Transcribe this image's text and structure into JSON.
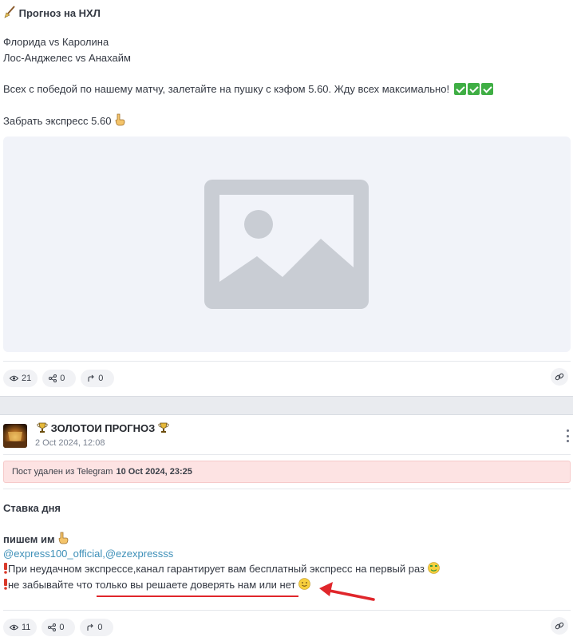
{
  "post1": {
    "title": "Прогноз на НХЛ",
    "title_icon": "broom-icon",
    "match1": "Флорида vs Каролина",
    "match2": "Лос-Анджелес vs Анахайм",
    "message": "Всех с победой по нашему матчу, залетайте на пушку с кэфом 5.60. Жду всех максимально!",
    "message_emoji": "check-mark-button-icon",
    "cta": "Забрать экспресс 5.60",
    "cta_emoji": "pointing-down-hand-icon",
    "image": "image-placeholder-icon",
    "stats": {
      "views": "21",
      "shares": "0",
      "forwards": "0"
    }
  },
  "post2": {
    "channel_name": "ЗОЛОТОИ ПРОГНОЗ",
    "channel_emoji": "trophy-icon",
    "date": "2 Oct 2024, 12:08",
    "deleted_notice": "Пост удален из Telegram",
    "deleted_date": "10 Oct 2024, 23:25",
    "heading": "Ставка дня",
    "write_us": "пишем им",
    "mentions": "@express100_official,@ezexpressss",
    "line1": "При неудачном экспрессе,канал гарантирует вам бесплатный экспресс на первый раз",
    "line2_prefix": "не забывайте что ",
    "line2_highlight": "только вы решаете доверять нам или нет",
    "stats": {
      "views": "11",
      "shares": "0",
      "forwards": "0"
    }
  },
  "colors": {
    "accent_red": "#e0262b",
    "mention": "#3d8fb8",
    "deleted_bg": "#fde3e3",
    "checkmark": "#3fae44"
  }
}
